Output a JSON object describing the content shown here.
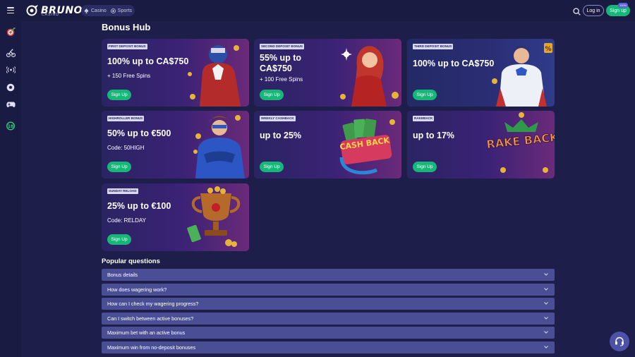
{
  "header": {
    "logo_text": "BRUNO",
    "logo_sub": "CASINO",
    "modes": [
      {
        "label": "Casino",
        "icon": "spade-icon"
      },
      {
        "label": "Sports",
        "icon": "ball-icon"
      }
    ],
    "login_label": "Log in",
    "signup_label": "Sign up",
    "signup_badge": "100%"
  },
  "sidebar": {
    "items": [
      {
        "icon": "target-dart-icon"
      },
      {
        "icon": "cycling-icon"
      },
      {
        "icon": "live-broadcast-icon"
      },
      {
        "icon": "soccer-ball-icon"
      },
      {
        "icon": "gamepad-icon"
      },
      {
        "icon": "eighteen-plus-icon"
      }
    ]
  },
  "page": {
    "title": "Bonus Hub"
  },
  "bonuses": [
    {
      "tag": "FIRST DEPOSIT BONUS",
      "headline": "100% up to CA$750",
      "sub": "+ 150 Free Spins",
      "cta": "Sign Up",
      "art": "superhero-red-icon"
    },
    {
      "tag": "SECOND DEPOSIT BONUS",
      "headline": "55% up to CA$750",
      "sub": "+ 100 Free Spins",
      "cta": "Sign Up",
      "art": "heroine-red-icon"
    },
    {
      "tag": "THIRD DEPOSIT BONUS",
      "headline": "100% up to CA$750",
      "sub": "",
      "cta": "Sign Up",
      "art": "superhero-blue-icon"
    },
    {
      "tag": "HIGHROLLER BONUS",
      "headline": "50% up to €500",
      "sub": "Code: 50HIGH",
      "cta": "Sign Up",
      "art": "masked-hero-icon"
    },
    {
      "tag": "WEEKLY CASHBACK",
      "headline": "up to 25%",
      "sub": "",
      "cta": "Sign Up",
      "art": "cash-back-icon",
      "art_text": "CASH BACK"
    },
    {
      "tag": "RAKEBACK",
      "headline": "up to 17%",
      "sub": "",
      "cta": "Sign Up",
      "art": "rake-back-icon",
      "art_text": "RAKE BACK"
    },
    {
      "tag": "SUNDAY RELOAD",
      "headline": "25% up to €100",
      "sub": "Code: RELDAY",
      "cta": "Sign Up",
      "art": "trophy-icon"
    }
  ],
  "faq": {
    "title": "Popular questions",
    "items": [
      "Bonus details",
      "How does wagering work?",
      "How can I check my wagering progress?",
      "Can I switch between active bonuses?",
      "Maximum bet with an active bonus",
      "Maximum win from no-deposit bonuses"
    ]
  },
  "colors": {
    "background": "#1d1f4a",
    "accent_green": "#17b77a",
    "faq_row": "#4a4f95"
  }
}
